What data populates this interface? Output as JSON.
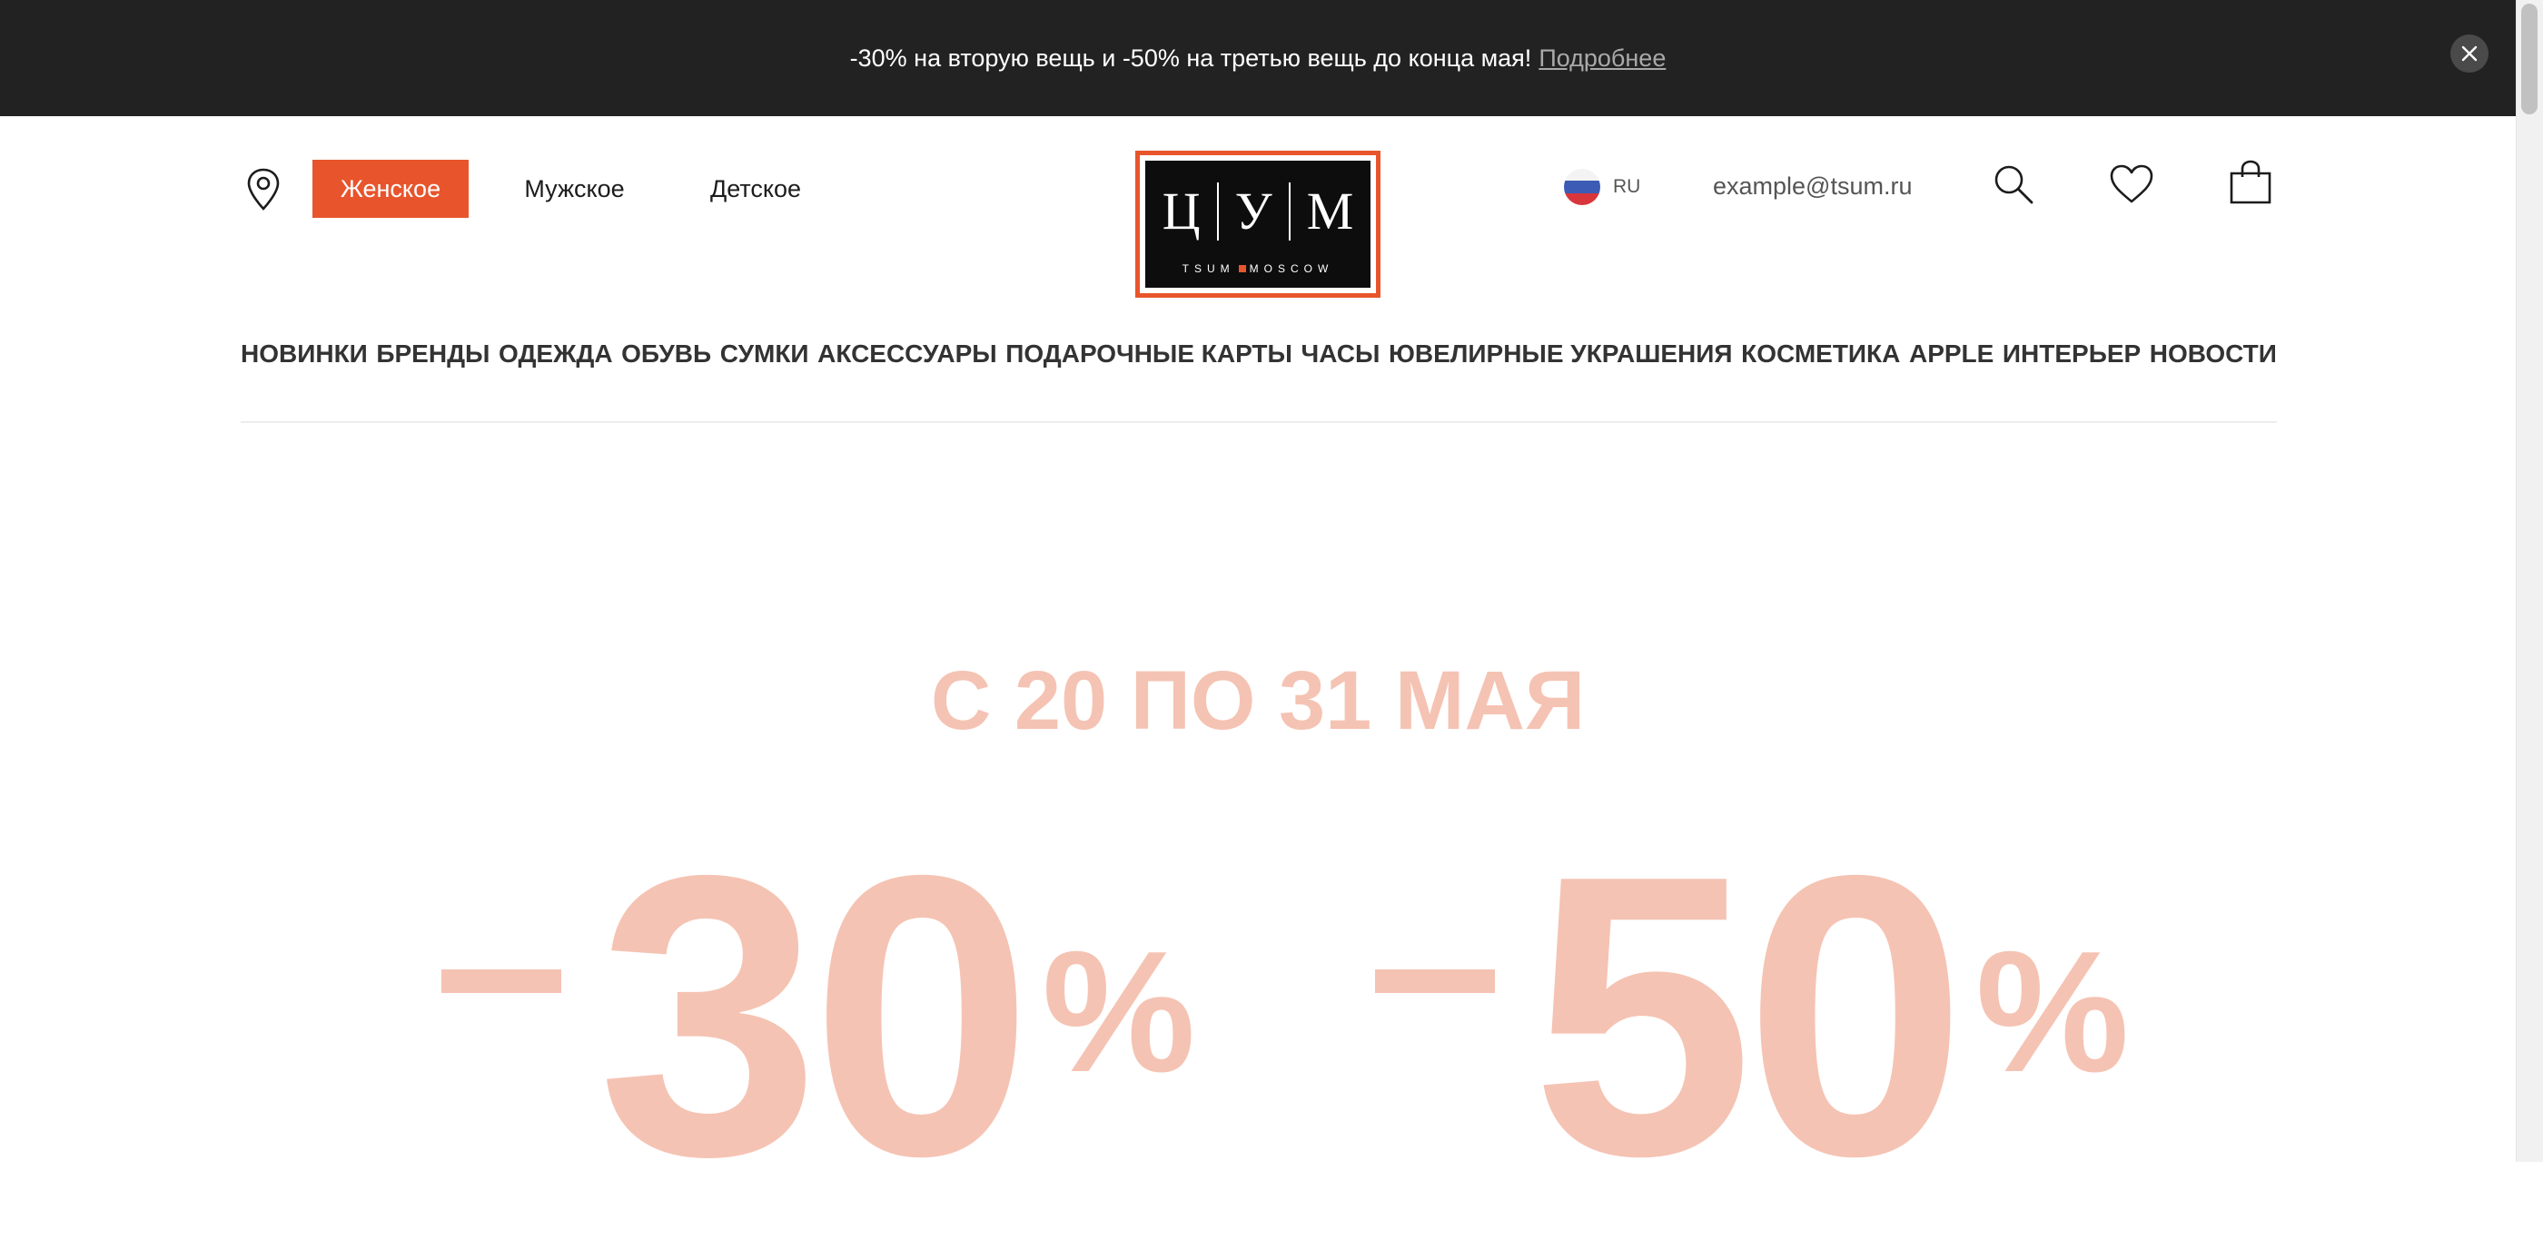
{
  "promo": {
    "text": "-30% на вторую вещь и -50% на третью вещь до конца мая!",
    "link": "Подробнее"
  },
  "header": {
    "gender_tabs": [
      {
        "label": "Женское",
        "active": true
      },
      {
        "label": "Мужское",
        "active": false
      },
      {
        "label": "Детское",
        "active": false
      }
    ],
    "logo": {
      "letters": [
        "Ц",
        "У",
        "М"
      ],
      "subtitle_left": "TSUM",
      "subtitle_right": "MOSCOW"
    },
    "language": "RU",
    "account_email": "example@tsum.ru",
    "icons": [
      "location-icon",
      "russia-flag-icon",
      "search-icon",
      "heart-icon",
      "shopping-bag-icon"
    ]
  },
  "nav": {
    "items": [
      "НОВИНКИ",
      "БРЕНДЫ",
      "ОДЕЖДА",
      "ОБУВЬ",
      "СУМКИ",
      "АКСЕССУАРЫ",
      "ПОДАРОЧНЫЕ КАРТЫ",
      "ЧАСЫ",
      "ЮВЕЛИРНЫЕ УКРАШЕНИЯ",
      "КОСМЕТИКА",
      "APPLE",
      "ИНТЕРЬЕР",
      "НОВОСТИ"
    ]
  },
  "hero": {
    "dates": "С 20 ПО 31 МАЯ",
    "discounts": [
      {
        "value": "30",
        "unit": "%"
      },
      {
        "value": "50",
        "unit": "%"
      }
    ]
  },
  "colors": {
    "accent": "#e8552c",
    "promo_bg": "#222222",
    "hero_text": "#f5c3b3"
  }
}
